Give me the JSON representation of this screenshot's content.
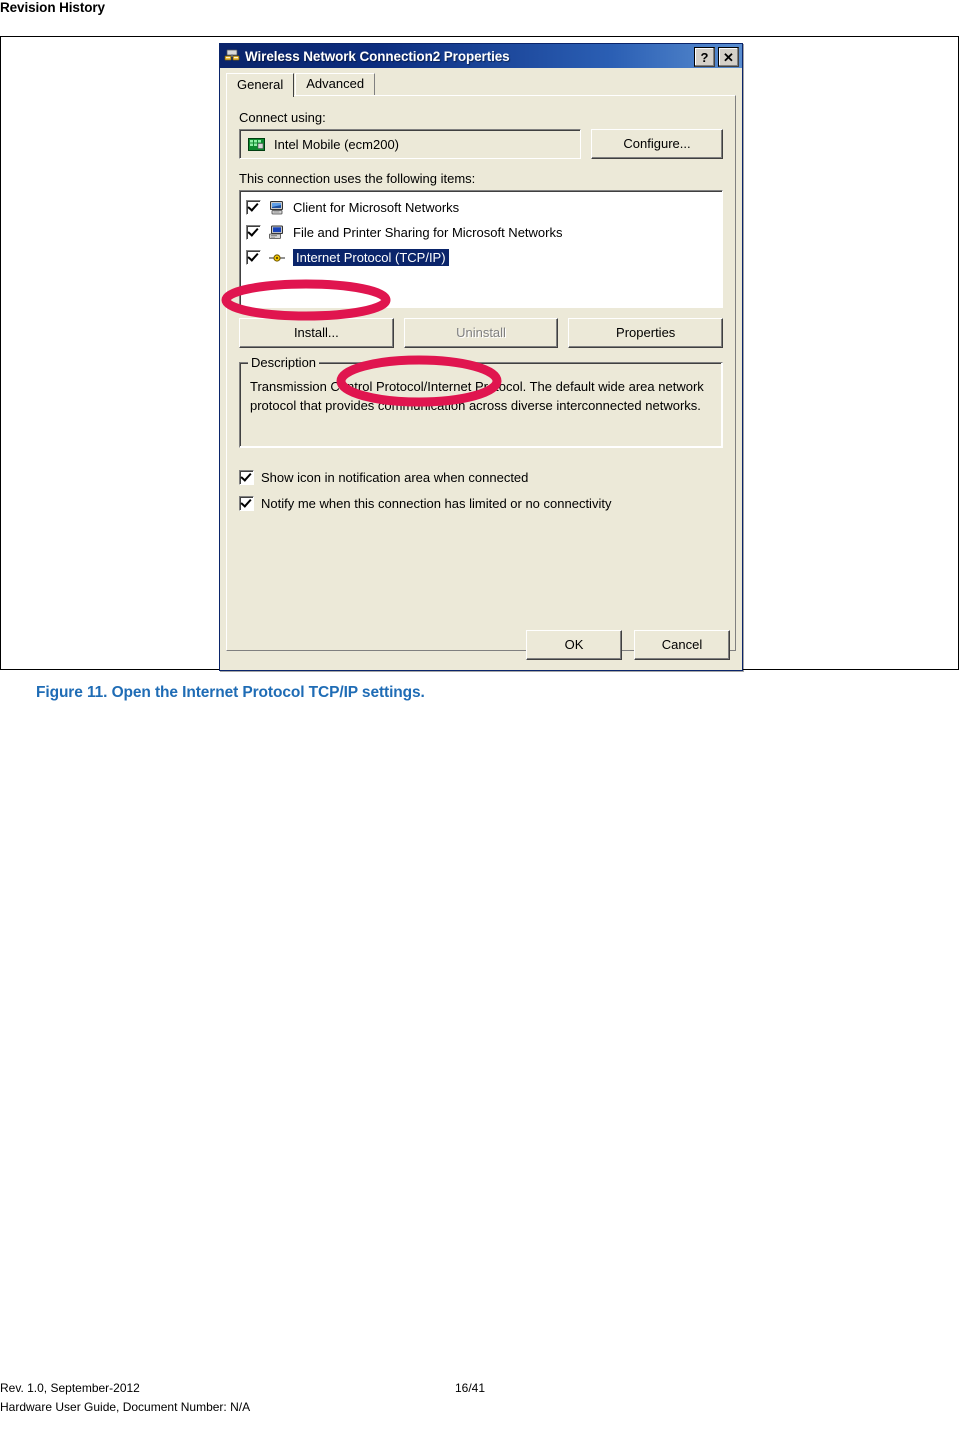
{
  "document": {
    "header": "Revision History",
    "figure_caption": "Figure 11. Open the Internet Protocol TCP/IP settings.",
    "footer": {
      "revision": "Rev. 1.0, September-2012",
      "page": "16/41",
      "doc_line": "Hardware User Guide, Document Number: N/A"
    }
  },
  "dialog": {
    "title": "Wireless Network Connection2 Properties",
    "title_icon": "network-connection-icon",
    "help_button": "?",
    "close_button": "✕",
    "tabs": [
      {
        "label": "General",
        "active": true
      },
      {
        "label": "Advanced",
        "active": false
      }
    ],
    "connect_using": {
      "label": "Connect using:",
      "adapter": "Intel Mobile (ecm200)",
      "adapter_icon": "network-adapter-icon",
      "configure_button": "Configure..."
    },
    "items_section": {
      "label": "This connection uses the following items:",
      "items": [
        {
          "label": "Client for Microsoft Networks",
          "checked": true,
          "selected": false,
          "icon": "client-computer-icon"
        },
        {
          "label": "File and Printer Sharing for Microsoft Networks",
          "checked": true,
          "selected": false,
          "icon": "file-printer-sharing-icon"
        },
        {
          "label": "Internet Protocol (TCP/IP)",
          "checked": true,
          "selected": true,
          "icon": "tcpip-protocol-icon"
        }
      ]
    },
    "item_buttons": {
      "install": "Install...",
      "uninstall": "Uninstall",
      "uninstall_disabled": true,
      "properties": "Properties"
    },
    "description": {
      "title": "Description",
      "text": "Transmission Control Protocol/Internet Protocol. The default wide area network protocol that provides communication across diverse interconnected networks."
    },
    "options": [
      {
        "label": "Show icon in notification area when connected",
        "checked": true
      },
      {
        "label": "Notify me when this connection has limited or no connectivity",
        "checked": true
      }
    ],
    "buttons": {
      "ok": "OK",
      "cancel": "Cancel"
    }
  },
  "annotations": {
    "color": "#e0154f",
    "ellipses": [
      {
        "name": "highlight-tcpip-item"
      },
      {
        "name": "highlight-properties-button"
      }
    ]
  }
}
